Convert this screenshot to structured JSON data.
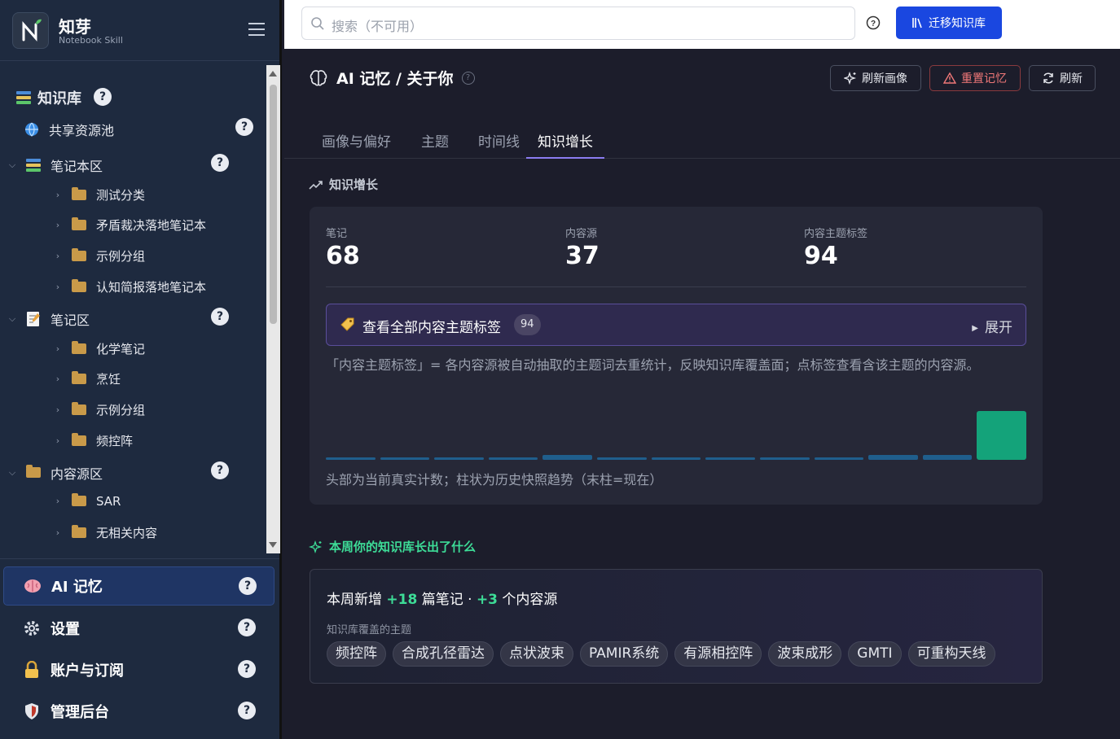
{
  "app": {
    "title": "知芽",
    "subtitle": "Notebook Skill"
  },
  "sidebar": {
    "section_title": "知识库",
    "items": [
      {
        "label": "共享资源池",
        "level": 0,
        "icon": "globe-icon",
        "help": true
      },
      {
        "label": "笔记本区",
        "level": 0,
        "icon": "books-icon",
        "expanded": true,
        "help": true
      },
      {
        "label": "测试分类",
        "level": 1,
        "icon": "folder-icon"
      },
      {
        "label": "矛盾裁决落地笔记本",
        "level": 1,
        "icon": "folder-icon"
      },
      {
        "label": "示例分组",
        "level": 1,
        "icon": "folder-icon"
      },
      {
        "label": "认知简报落地笔记本",
        "level": 1,
        "icon": "folder-icon"
      },
      {
        "label": "笔记区",
        "level": 0,
        "icon": "memo-icon",
        "expanded": true,
        "help": true
      },
      {
        "label": "化学笔记",
        "level": 1,
        "icon": "folder-icon"
      },
      {
        "label": "烹饪",
        "level": 1,
        "icon": "folder-icon"
      },
      {
        "label": "示例分组",
        "level": 1,
        "icon": "folder-icon"
      },
      {
        "label": "频控阵",
        "level": 1,
        "icon": "folder-icon"
      },
      {
        "label": "内容源区",
        "level": 0,
        "icon": "folder-icon",
        "expanded": true,
        "help": true
      },
      {
        "label": "SAR",
        "level": 1,
        "icon": "folder-icon"
      },
      {
        "label": "无相关内容",
        "level": 1,
        "icon": "folder-icon"
      }
    ],
    "nav": [
      {
        "label": "AI 记忆",
        "icon": "brain-icon",
        "active": true
      },
      {
        "label": "设置",
        "icon": "gear-icon"
      },
      {
        "label": "账户与订阅",
        "icon": "lock-icon"
      },
      {
        "label": "管理后台",
        "icon": "shield-icon"
      }
    ],
    "help_glyph": "?"
  },
  "topbar": {
    "search_placeholder": "搜索（不可用）",
    "migrate_label": "迁移知识库"
  },
  "page": {
    "title": "AI 记忆 / 关于你",
    "buttons": {
      "refresh_profile": "刷新画像",
      "reset_memory": "重置记忆",
      "refresh": "刷新"
    },
    "tabs": [
      "画像与偏好",
      "主题",
      "时间线",
      "知识增长"
    ],
    "active_tab": "知识增长"
  },
  "growth": {
    "section_title": "知识增长",
    "stats": [
      {
        "label": "笔记",
        "value": "68"
      },
      {
        "label": "内容源",
        "value": "37"
      },
      {
        "label": "内容主题标签",
        "value": "94"
      }
    ],
    "tags_expander": {
      "label": "查看全部内容主题标签",
      "count": "94",
      "toggle": "展开"
    },
    "description": "「内容主题标签」= 各内容源被自动抽取的主题词去重统计，反映知识库覆盖面；点标签查看含该主题的内容源。",
    "trend_values": [
      1,
      1,
      1,
      1,
      2,
      1,
      1,
      1,
      1,
      1,
      2,
      2,
      20
    ],
    "footnote": "头部为当前真实计数；柱状为历史快照趋势（末柱=现在）"
  },
  "weekly": {
    "section_title": "本周你的知识库长出了什么",
    "prefix": "本周新增",
    "notes_delta": "+18",
    "notes_text": "篇笔记 · ",
    "sources_delta": "+3",
    "sources_text": "个内容源",
    "coverage_label": "知识库覆盖的主题",
    "topics": [
      "频控阵",
      "合成孔径雷达",
      "点状波束",
      "PAMIR系统",
      "有源相控阵",
      "波束成形",
      "GMTI",
      "可重构天线"
    ]
  },
  "colors": {
    "accent": "#1a47e0",
    "success": "#3ddc97",
    "bar": "#1f5e8c",
    "bar_now": "#14a37a",
    "tab_underline": "#8b7cf0"
  }
}
